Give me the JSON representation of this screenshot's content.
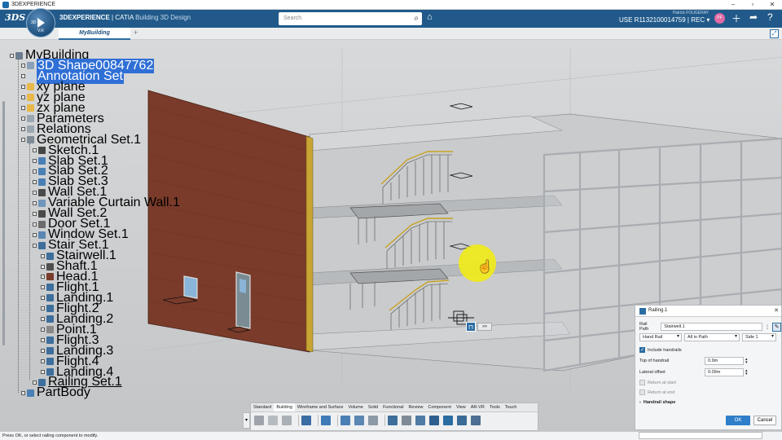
{
  "window": {
    "title": "3DEXPERIENCE",
    "controls": [
      "–",
      "▫",
      "✕"
    ]
  },
  "topbar": {
    "brand_bold": "3DEXPERIENCE",
    "brand_sep": " | CATIA ",
    "brand_app": "Building 3D Design",
    "compass_version": "V.R",
    "compass_left": "3D",
    "search_placeholder": "Search",
    "user_name": "Patrick FOUGERAY",
    "context": "USE R1132100014759 | REC ▾",
    "avatar_initials": "PF"
  },
  "tabs": {
    "active": "MyBuilding",
    "add": "+"
  },
  "tree": [
    {
      "label": "MyBuilding",
      "level": 0,
      "icon": "assembly-icon",
      "color": "#6b7d8f"
    },
    {
      "label": "3D Shape00847762",
      "level": 1,
      "icon": "shape-icon",
      "color": "#8aa0b8",
      "selected": true
    },
    {
      "label": "Annotation Set",
      "level": 1,
      "icon": "annotation-icon",
      "color": "#cfd8e0",
      "selected": true
    },
    {
      "label": "xy plane",
      "level": 1,
      "icon": "plane-icon",
      "color": "#e8b84a"
    },
    {
      "label": "yz plane",
      "level": 1,
      "icon": "plane-icon",
      "color": "#e8b84a"
    },
    {
      "label": "zx plane",
      "level": 1,
      "icon": "plane-icon",
      "color": "#e8b84a"
    },
    {
      "label": "Parameters",
      "level": 1,
      "icon": "parameters-icon",
      "color": "#9aa6b0"
    },
    {
      "label": "Relations",
      "level": 1,
      "icon": "relations-icon",
      "color": "#9aa6b0"
    },
    {
      "label": "Geometrical Set.1",
      "level": 1,
      "icon": "geometrical-set-icon",
      "color": "#7e8a96"
    },
    {
      "label": "Sketch.1",
      "level": 2,
      "icon": "sketch-icon",
      "color": "#444444"
    },
    {
      "label": "Slab Set.1",
      "level": 2,
      "icon": "slab-icon",
      "color": "#4a7fb5"
    },
    {
      "label": "Slab Set.2",
      "level": 2,
      "icon": "slab-icon",
      "color": "#4a7fb5"
    },
    {
      "label": "Slab Set.3",
      "level": 2,
      "icon": "slab-icon",
      "color": "#4a7fb5"
    },
    {
      "label": "Wall Set.1",
      "level": 2,
      "icon": "wall-icon",
      "color": "#4a4a4a"
    },
    {
      "label": "Variable Curtain Wall.1",
      "level": 2,
      "icon": "curtain-wall-icon",
      "color": "#6f95bb"
    },
    {
      "label": "Wall Set.2",
      "level": 2,
      "icon": "wall-icon",
      "color": "#4a4a4a"
    },
    {
      "label": "Door Set.1",
      "level": 2,
      "icon": "door-icon",
      "color": "#6b6b6b"
    },
    {
      "label": "Window Set.1",
      "level": 2,
      "icon": "window-icon",
      "color": "#5b87b3"
    },
    {
      "label": "Stair Set.1",
      "level": 2,
      "icon": "stair-icon",
      "color": "#3d6e9c"
    },
    {
      "label": "Stairwell.1",
      "level": 3,
      "icon": "stairwell-icon",
      "color": "#3d6e9c"
    },
    {
      "label": "Shaft.1",
      "level": 3,
      "icon": "shaft-icon",
      "color": "#4f4f4f"
    },
    {
      "label": "Head.1",
      "level": 3,
      "icon": "head-icon",
      "color": "#7a3b2a"
    },
    {
      "label": "Flight.1",
      "level": 3,
      "icon": "flight-icon",
      "color": "#3d6e9c"
    },
    {
      "label": "Landing.1",
      "level": 3,
      "icon": "landing-icon",
      "color": "#3d6e9c"
    },
    {
      "label": "Flight.2",
      "level": 3,
      "icon": "flight-icon",
      "color": "#3d6e9c"
    },
    {
      "label": "Landing.2",
      "level": 3,
      "icon": "landing-icon",
      "color": "#3d6e9c"
    },
    {
      "label": "Point.1",
      "level": 3,
      "icon": "point-icon",
      "color": "#888888"
    },
    {
      "label": "Flight.3",
      "level": 3,
      "icon": "flight-icon",
      "color": "#3d6e9c"
    },
    {
      "label": "Landing.3",
      "level": 3,
      "icon": "landing-icon",
      "color": "#3d6e9c"
    },
    {
      "label": "Flight.4",
      "level": 3,
      "icon": "flight-icon",
      "color": "#3d6e9c"
    },
    {
      "label": "Landing.4",
      "level": 3,
      "icon": "landing-icon",
      "color": "#3d6e9c"
    },
    {
      "label": "Railing Set.1",
      "level": 2,
      "icon": "railing-icon",
      "color": "#3d6e9c",
      "underlined": true
    },
    {
      "label": "PartBody",
      "level": 1,
      "icon": "partbody-icon",
      "color": "#4a7fb5"
    }
  ],
  "mini_toolbar": {
    "more": ">>"
  },
  "panel": {
    "title": "Railing.1",
    "close": "✕",
    "rail_path_label": "Rail Path",
    "rail_path_value": "Stairwell.1",
    "hand_rail": "Hand Rail",
    "all_in_path": "All in Path",
    "side": "Side 1",
    "include_handrails": "Include handrails",
    "top_of_handrail_label": "Top of handrail",
    "top_of_handrail_value": "0.9m",
    "lateral_offset_label": "Lateral offset",
    "lateral_offset_value": "0.09m",
    "return_at_start": "Return at start",
    "return_at_end": "Return at end",
    "handrail_shape": "Handrail shape",
    "ok": "OK",
    "cancel": "Cancel"
  },
  "action_bar": {
    "tabs": [
      "Standard",
      "Building",
      "Wireframe and Surface",
      "Volume",
      "Solid",
      "Functional",
      "Review",
      "Component",
      "View",
      "AR-VR",
      "Tools",
      "Touch"
    ],
    "active_tab": "Building"
  },
  "status": {
    "message": "Press OK, or select railing component to modify."
  },
  "colors": {
    "accent": "#215a8a",
    "selection": "#2f6fd6",
    "brick": "#7a3b2a",
    "glass_frame": "#a9adb1",
    "cursor_highlight": "#f0ea1a"
  }
}
